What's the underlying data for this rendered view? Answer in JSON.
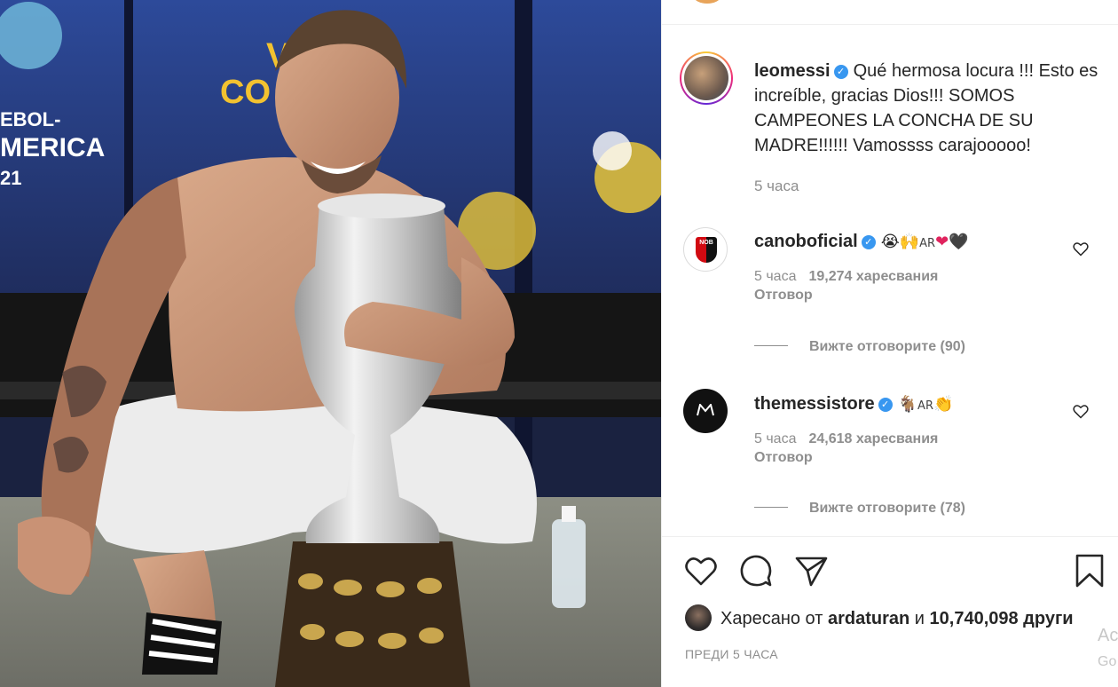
{
  "post": {
    "author": "leomessi",
    "caption": "Qué hermosa locura !!! Esto es increíble, gracias Dios!!! SOMOS CAMPEONES LA CONCHA DE SU MADRE!!!!!! Vamossss carajooooo!",
    "time": "5 часа"
  },
  "photo": {
    "banner_text_1": "V        O",
    "banner_text_2": "CO          ITE.",
    "left_text_1": "EBOL-",
    "left_text_2": "MERICA",
    "left_text_3": "21"
  },
  "comments": [
    {
      "username": "canoboficial",
      "emojis": "😭🙌",
      "flag_text": "AR",
      "emojis_after": "❤🖤",
      "time": "5 часа",
      "likes": "19,274 харесвания",
      "reply": "Отговор",
      "view_replies": "Вижте отговорите (90)"
    },
    {
      "username": "themessistore",
      "emojis": "🐐",
      "flag_text": "AR",
      "emojis_after": "👏",
      "time": "5 часа",
      "likes": "24,618 харесвания",
      "reply": "Отговор",
      "view_replies": "Вижте отговорите (78)"
    }
  ],
  "liked_by": {
    "prefix": "Харесано от",
    "user": "ardaturan",
    "joiner": "и",
    "count": "10,740,098 други"
  },
  "posted_ago": "ПРЕДИ 5 ЧАСА",
  "edge_fragments": [
    "Ac",
    "Go"
  ],
  "icons": {
    "like": "heart-icon",
    "comment": "comment-icon",
    "share": "share-icon",
    "save": "bookmark-icon",
    "verified": "verified-badge-icon"
  },
  "colors": {
    "verified": "#3897f0",
    "secondary_text": "#8e8e8e",
    "text": "#262626"
  }
}
